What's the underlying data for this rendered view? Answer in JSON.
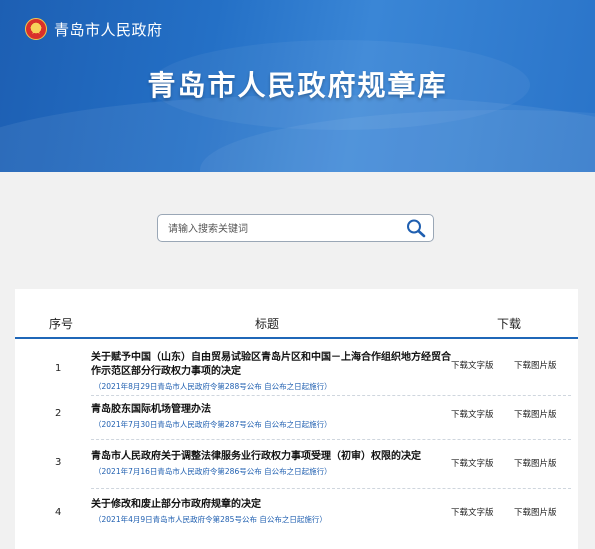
{
  "header": {
    "brand_name": "青岛市人民政府",
    "site_title": "青岛市人民政府规章库"
  },
  "search": {
    "placeholder": "请输入搜索关键词"
  },
  "table": {
    "columns": {
      "no": "序号",
      "title": "标题",
      "download": "下载"
    },
    "rows": [
      {
        "no": "1",
        "title": "关于赋予中国（山东）自由贸易试验区青岛片区和中国－上海合作组织地方经贸合作示范区部分行政权力事项的决定",
        "meta": "（2021年8月29日青岛市人民政府令第288号公布  自公布之日起施行）",
        "dl_text": "下载文字版",
        "dl_img": "下载图片版"
      },
      {
        "no": "2",
        "title": "青岛胶东国际机场管理办法",
        "meta": "（2021年7月30日青岛市人民政府令第287号公布  自公布之日起施行）",
        "dl_text": "下载文字版",
        "dl_img": "下载图片版"
      },
      {
        "no": "3",
        "title": "青岛市人民政府关于调整法律服务业行政权力事项受理（初审）权限的决定",
        "meta": "（2021年7月16日青岛市人民政府令第286号公布  自公布之日起施行）",
        "dl_text": "下载文字版",
        "dl_img": "下载图片版"
      },
      {
        "no": "4",
        "title": "关于修改和废止部分市政府规章的决定",
        "meta": "（2021年4月9日青岛市人民政府令第285号公布  自公布之日起施行）",
        "dl_text": "下载文字版",
        "dl_img": "下载图片版"
      }
    ]
  }
}
